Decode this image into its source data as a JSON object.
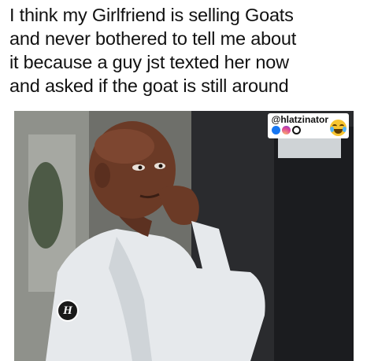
{
  "caption": {
    "lines": [
      "I think my Girlfriend is selling Goats",
      "and never bothered to tell me about",
      "it because a guy jst texted her now",
      "and asked if the goat is still around"
    ]
  },
  "watermark": {
    "handle": "@hlatzinator",
    "social_icons": [
      "facebook-icon",
      "instagram-icon",
      "ring-icon"
    ],
    "emoji": "laughing-tears-emoji-icon"
  },
  "logo_badge": {
    "letter": "H"
  },
  "colors": {
    "text": "#111111",
    "background": "#ffffff",
    "shirt": "#e9ecef",
    "skin": "#6b3a26"
  }
}
